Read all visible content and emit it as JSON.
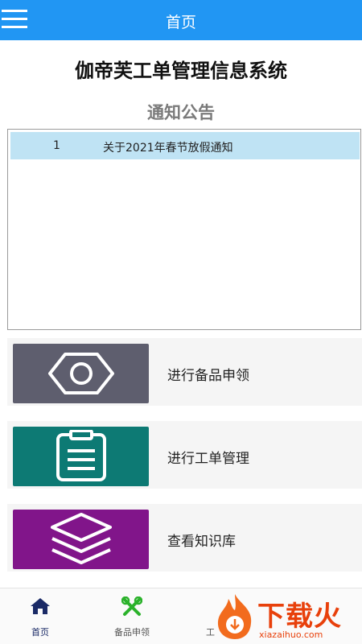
{
  "header": {
    "title": "首页",
    "menu_icon": "hamburger-menu-icon"
  },
  "app_title": "伽帝芙工单管理信息系统",
  "notice": {
    "heading": "通知公告",
    "items": [
      {
        "index": "1",
        "title": "关于2021年春节放假通知"
      }
    ]
  },
  "actions": [
    {
      "label": "进行备品申领",
      "icon": "hexagon-nut-icon",
      "color": "#5e5e6e"
    },
    {
      "label": "进行工单管理",
      "icon": "clipboard-icon",
      "color": "#0d7a74"
    },
    {
      "label": "查看知识库",
      "icon": "layers-icon",
      "color": "#81158a"
    }
  ],
  "bottom_nav": [
    {
      "label": "首页",
      "icon": "home-icon",
      "active": true
    },
    {
      "label": "备品申领",
      "icon": "tools-icon",
      "active": false
    },
    {
      "label": "工",
      "icon": "work-order-icon",
      "active": false
    }
  ],
  "watermark": {
    "text": "下载火",
    "sub": "xiazaihuo.com"
  }
}
